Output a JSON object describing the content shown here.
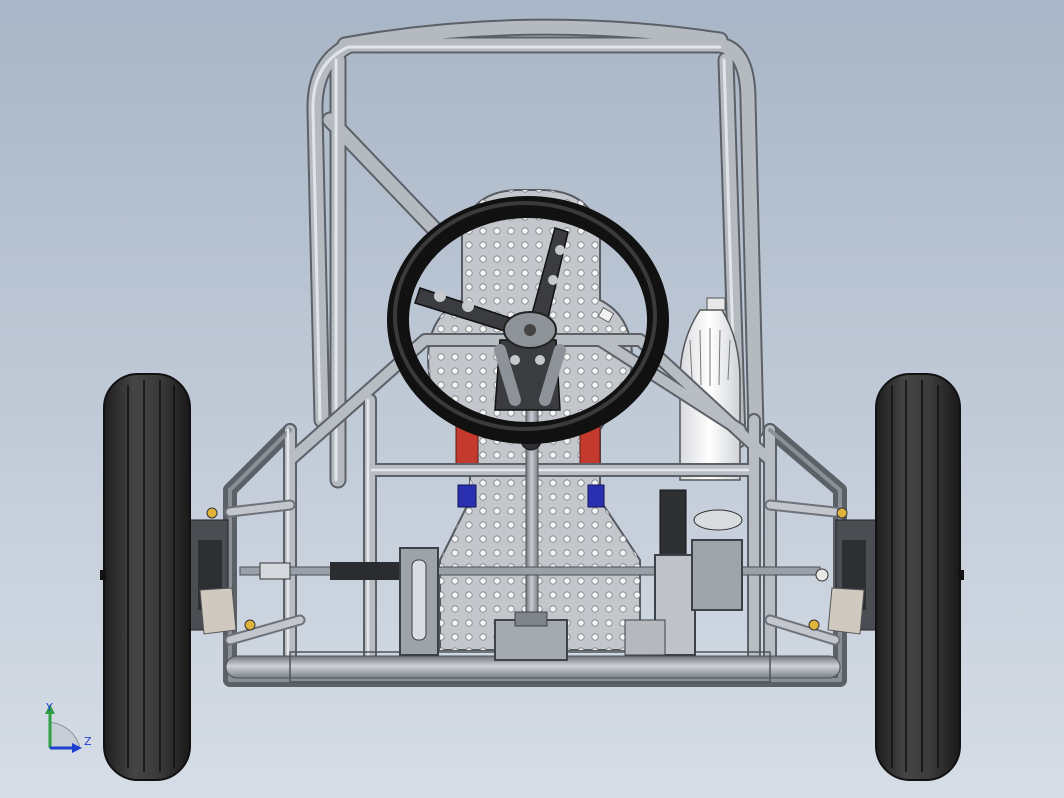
{
  "viewport": {
    "background_top": "#a9b6c7",
    "background_bottom": "#d6dde6"
  },
  "model": {
    "tube_color": "#a8adb6",
    "tube_dark": "#5f646c",
    "tire_color": "#2b2b2b",
    "steering_wheel_color": "#1c1c1c",
    "seat_color": "#c3c6cb",
    "accent_red": "#c43a2e",
    "accent_blue": "#2a2fb0"
  },
  "triad": {
    "y_label": "Y",
    "z_label": "Z",
    "y_color": "#2ea043",
    "z_color": "#1f3fd1",
    "x_color": "#c8ced6"
  }
}
